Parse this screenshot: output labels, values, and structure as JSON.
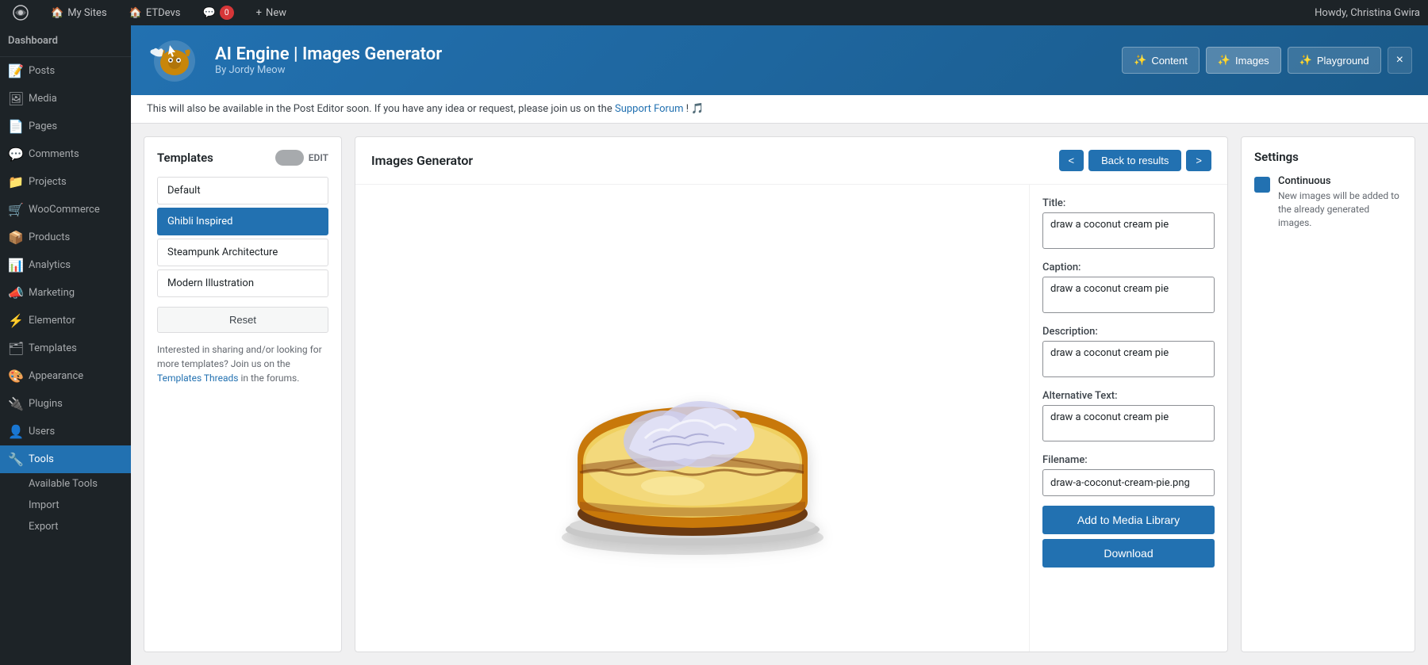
{
  "adminbar": {
    "logo": "⚙",
    "items": [
      {
        "label": "My Sites",
        "icon": "🏠"
      },
      {
        "label": "ETDevs",
        "icon": "🏠"
      },
      {
        "label": "0",
        "icon": "💬"
      },
      {
        "label": "New",
        "icon": "+"
      }
    ],
    "user": "Howdy, Christina Gwira"
  },
  "sidebar": {
    "dashboard_label": "Dashboard",
    "items": [
      {
        "label": "Posts",
        "icon": "📝",
        "id": "posts"
      },
      {
        "label": "Media",
        "icon": "🖼",
        "id": "media"
      },
      {
        "label": "Pages",
        "icon": "📄",
        "id": "pages"
      },
      {
        "label": "Comments",
        "icon": "💬",
        "id": "comments"
      },
      {
        "label": "Projects",
        "icon": "📁",
        "id": "projects"
      },
      {
        "label": "WooCommerce",
        "icon": "🛒",
        "id": "woocommerce"
      },
      {
        "label": "Products",
        "icon": "📦",
        "id": "products"
      },
      {
        "label": "Analytics",
        "icon": "📊",
        "id": "analytics"
      },
      {
        "label": "Marketing",
        "icon": "📣",
        "id": "marketing"
      },
      {
        "label": "Elementor",
        "icon": "⚡",
        "id": "elementor"
      },
      {
        "label": "Templates",
        "icon": "🗂",
        "id": "templates"
      },
      {
        "label": "Appearance",
        "icon": "🎨",
        "id": "appearance"
      },
      {
        "label": "Plugins",
        "icon": "🔌",
        "id": "plugins"
      },
      {
        "label": "Users",
        "icon": "👤",
        "id": "users"
      },
      {
        "label": "Tools",
        "icon": "🔧",
        "id": "tools",
        "active": true
      },
      {
        "label": "Available Tools",
        "sub": true,
        "id": "available-tools"
      },
      {
        "label": "Import",
        "sub": true,
        "id": "import"
      },
      {
        "label": "Export",
        "sub": true,
        "id": "export"
      }
    ]
  },
  "plugin_header": {
    "title": "AI Engine | Images Generator",
    "subtitle": "By Jordy Meow",
    "buttons": [
      {
        "label": "Content",
        "id": "content",
        "icon": "✨"
      },
      {
        "label": "Images",
        "id": "images",
        "icon": "✨"
      },
      {
        "label": "Playground",
        "id": "playground",
        "icon": "✨"
      },
      {
        "label": "×",
        "id": "close"
      }
    ]
  },
  "info_bar": {
    "text": "This will also be available in the Post Editor soon. If you have any idea or request, please join us on the",
    "link_text": "Support Forum",
    "suffix": "! 🎵"
  },
  "templates_panel": {
    "title": "Templates",
    "edit_label": "EDIT",
    "items": [
      {
        "label": "Default",
        "id": "default"
      },
      {
        "label": "Ghibli Inspired",
        "id": "ghibli",
        "selected": true
      },
      {
        "label": "Steampunk Architecture",
        "id": "steampunk"
      },
      {
        "label": "Modern Illustration",
        "id": "modern"
      }
    ],
    "reset_label": "Reset",
    "note": "Interested in sharing and/or looking for more templates? Join us on the",
    "note_link": "Templates Threads",
    "note_suffix": "in the forums."
  },
  "generator": {
    "title": "Images Generator",
    "nav": {
      "prev_label": "<",
      "back_label": "Back to results",
      "next_label": ">"
    }
  },
  "meta": {
    "title_label": "Title:",
    "title_value": "draw a coconut cream pie",
    "caption_label": "Caption:",
    "caption_value": "draw a coconut cream pie",
    "description_label": "Description:",
    "description_value": "draw a coconut cream pie",
    "alt_label": "Alternative Text:",
    "alt_value": "draw a coconut cream pie",
    "filename_label": "Filename:",
    "filename_value": "draw-a-coconut-cream-pie.png",
    "add_library_label": "Add to Media Library",
    "download_label": "Download"
  },
  "settings": {
    "title": "Settings",
    "items": [
      {
        "id": "continuous",
        "label": "Continuous",
        "description": "New images will be added to the already generated images.",
        "checked": true
      }
    ]
  }
}
